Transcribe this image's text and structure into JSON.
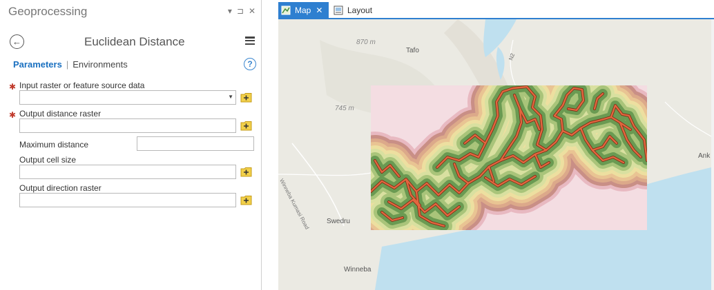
{
  "pane": {
    "title": "Geoprocessing",
    "controls": {
      "menu": "▾",
      "pin": "⊐",
      "close": "✕"
    },
    "tool_title": "Euclidean Distance",
    "tabs": {
      "parameters": "Parameters",
      "separator": "|",
      "environments": "Environments"
    },
    "help": "?",
    "required_marker": "✱",
    "params": {
      "input": {
        "label": "Input raster or feature source data",
        "value": ""
      },
      "output_distance": {
        "label": "Output distance raster",
        "value": ""
      },
      "max_distance": {
        "label": "Maximum distance",
        "value": ""
      },
      "cell_size": {
        "label": "Output cell size",
        "value": ""
      },
      "direction": {
        "label": "Output direction raster",
        "value": ""
      }
    }
  },
  "view_tabs": {
    "map": "Map",
    "map_close": "✕",
    "layout": "Layout"
  },
  "map": {
    "labels": {
      "elev_870": "870 m",
      "tafo": "Tafo",
      "n2": "N2",
      "elev_745": "745 m",
      "winneba_road": "Winneba Kumasi Road",
      "swedru": "Swedru",
      "winneba": "Winneba",
      "ank": "Ank"
    },
    "colors": {
      "land": "#ebeae3",
      "water": "#bfe0ef",
      "roads": "#e2673f",
      "distance_bands": [
        "#6a9a52",
        "#a9c47a",
        "#d9e0a0",
        "#eddfa0",
        "#e9c493",
        "#dca98a",
        "#c98f86",
        "#e8b9c1",
        "#f4dde2"
      ]
    }
  }
}
